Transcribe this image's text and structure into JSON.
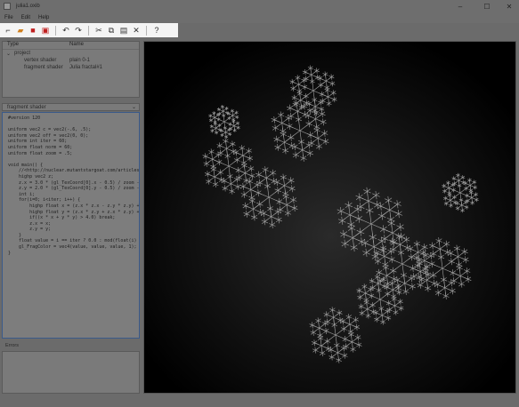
{
  "window": {
    "title": "julia1.oxib"
  },
  "menu": [
    "File",
    "Edit",
    "Help"
  ],
  "tree": {
    "col_type": "Type",
    "col_name": "Name",
    "root": "project",
    "items": [
      {
        "type": "vertex shader",
        "name": "plain 0-1"
      },
      {
        "type": "fragment shader",
        "name": "Julia fractal#1"
      }
    ]
  },
  "editor": {
    "title": "fragment shader",
    "lines": [
      "#version 120",
      "",
      "uniform vec2 c = vec2(-.6, .5);",
      "uniform vec2 off = vec2(0, 0);",
      "uniform int iter = 60;",
      "uniform float norm = 60;",
      "uniform float zoom = .5;",
      "",
      "void main() {",
      "    //<http://nuclear.mutantstargoat.com/articles/sdr_fract/>",
      "    highp vec2 z;",
      "    z.x = 3.0 * (gl_TexCoord[0].x - 0.5) / zoom - off.x;",
      "    z.y = 2.0 * (gl_TexCoord[0].y - 0.5) / zoom - off.y;",
      "    int i;",
      "    for(i=0; i<iter; i++) {",
      "        highp float x = (z.x * z.x - z.y * z.y) + c.x;",
      "        highp float y = (z.x * z.y + z.x * z.y) + c.y;",
      "        if((x * x + y * y) > 4.0) break;",
      "        z.x = x;",
      "        z.y = y;",
      "    }",
      "    float value = i == iter ? 0.0 : mod(float(i) / norm, 1.);",
      "    gl_FragColor = vec4(value, value, value, 1);",
      "}"
    ]
  },
  "errors": {
    "title": "Errors"
  }
}
